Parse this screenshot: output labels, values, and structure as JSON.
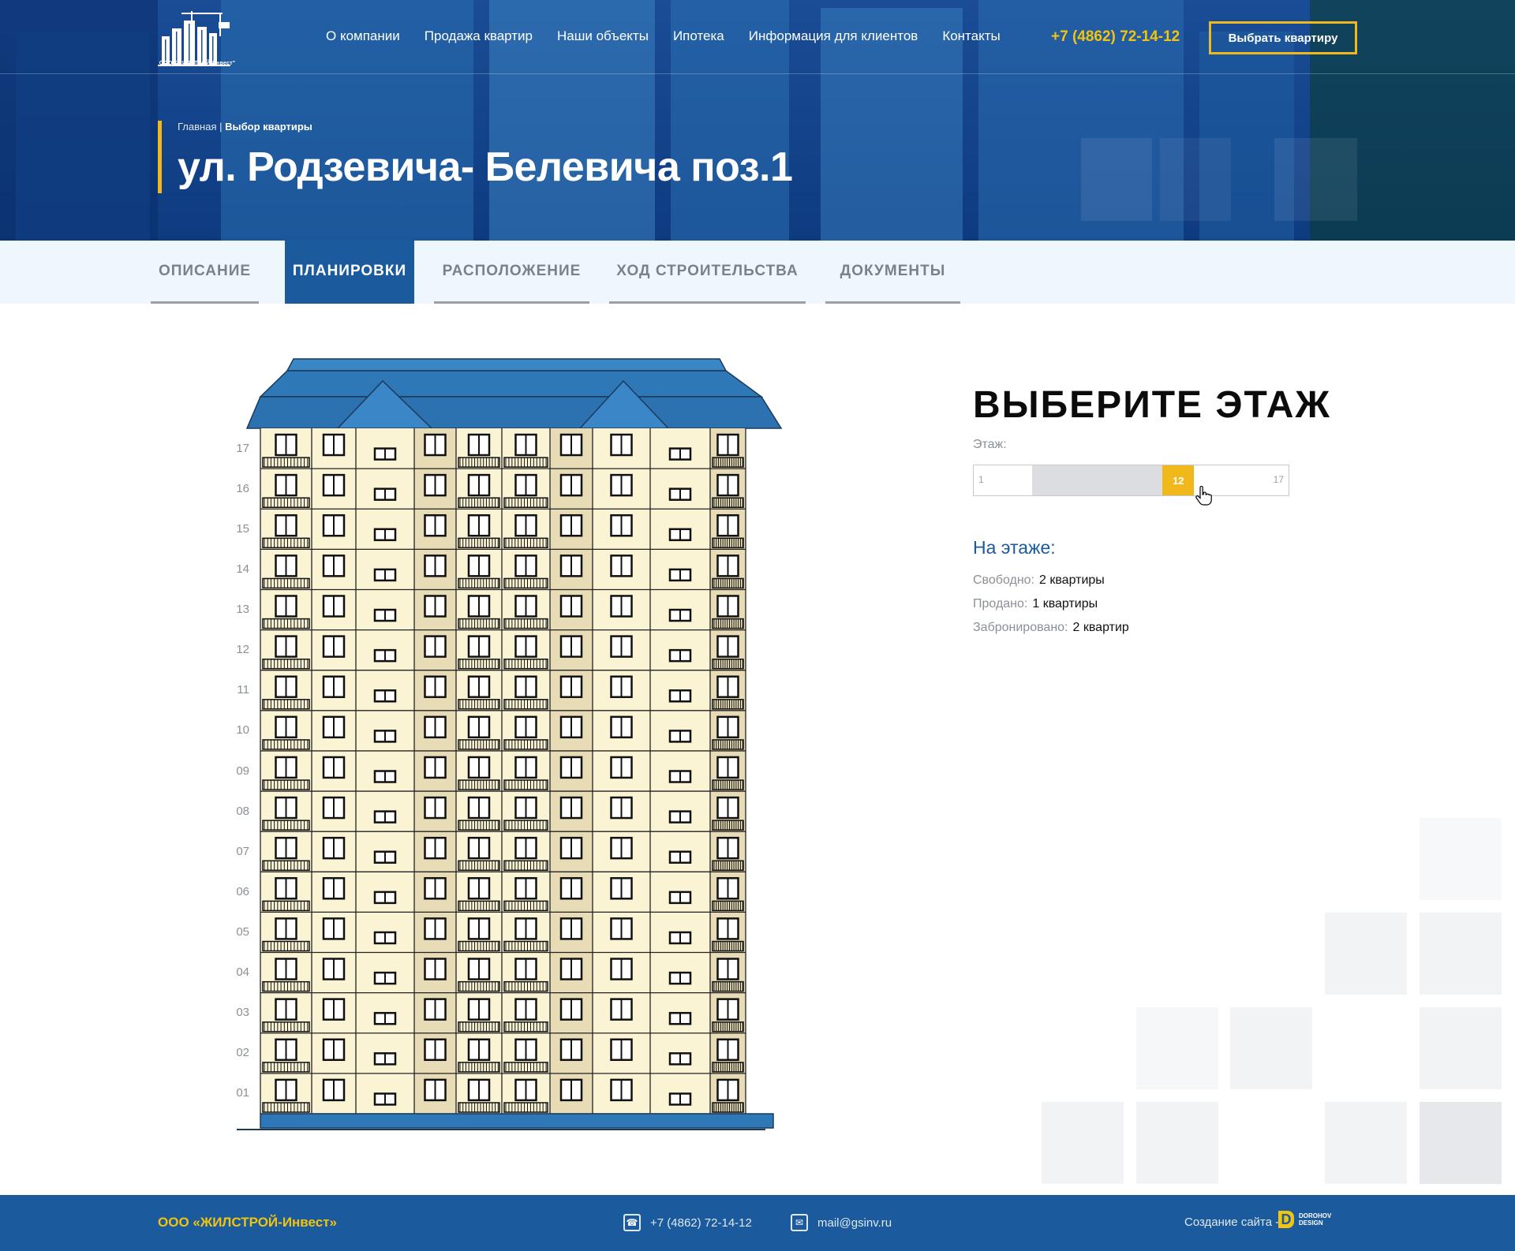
{
  "header": {
    "logo_text": "ООО \"ЖИЛСТРОЙ-Инвест\"",
    "nav": [
      "О компании",
      "Продажа квартир",
      "Наши объекты",
      "Ипотека",
      "Информация для клиентов",
      "Контакты"
    ],
    "phone": "+7 (4862) 72-14-12",
    "cta_label": "Выбрать квартиру"
  },
  "hero": {
    "breadcrumb_home": "Главная",
    "breadcrumb_separator": "|",
    "breadcrumb_current": "Выбор квартиры",
    "title": "ул. Родзевича- Белевича поз.1"
  },
  "tabs": [
    {
      "label": "ОПИСАНИЕ",
      "active": false
    },
    {
      "label": "ПЛАНИРОВКИ",
      "active": true
    },
    {
      "label": "РАСПОЛОЖЕНИЕ",
      "active": false
    },
    {
      "label": "ХОД СТРОИТЕЛЬСТВА",
      "active": false
    },
    {
      "label": "ДОКУМЕНТЫ",
      "active": false
    }
  ],
  "building": {
    "floors": [
      "17",
      "16",
      "15",
      "14",
      "13",
      "12",
      "11",
      "10",
      "09",
      "08",
      "07",
      "06",
      "05",
      "04",
      "03",
      "02",
      "01"
    ]
  },
  "floor_picker": {
    "title": "ВЫБЕРИТЕ ЭТАЖ",
    "caption": "Этаж:",
    "min": "1",
    "max": "17",
    "selected": "12"
  },
  "on_floor": {
    "title": "На этаже:",
    "stats": [
      {
        "label": "Свободно:",
        "value": "2 квартиры"
      },
      {
        "label": "Продано:",
        "value": "1 квартиры"
      },
      {
        "label": "Забронировано:",
        "value": "2 квартир"
      }
    ]
  },
  "footer": {
    "company": "ООО «ЖИЛСТРОЙ-Инвест»",
    "phone": "+7 (4862) 72-14-12",
    "email": "mail@gsinv.ru",
    "credit": "Создание сайта -",
    "studio_line1": "DOROHOV",
    "studio_line2": "DESIGN"
  },
  "colors": {
    "accent": "#f1b81c",
    "primary": "#1b5a9c",
    "facade": "#fbf4d4",
    "roof": "#2e78b8"
  }
}
